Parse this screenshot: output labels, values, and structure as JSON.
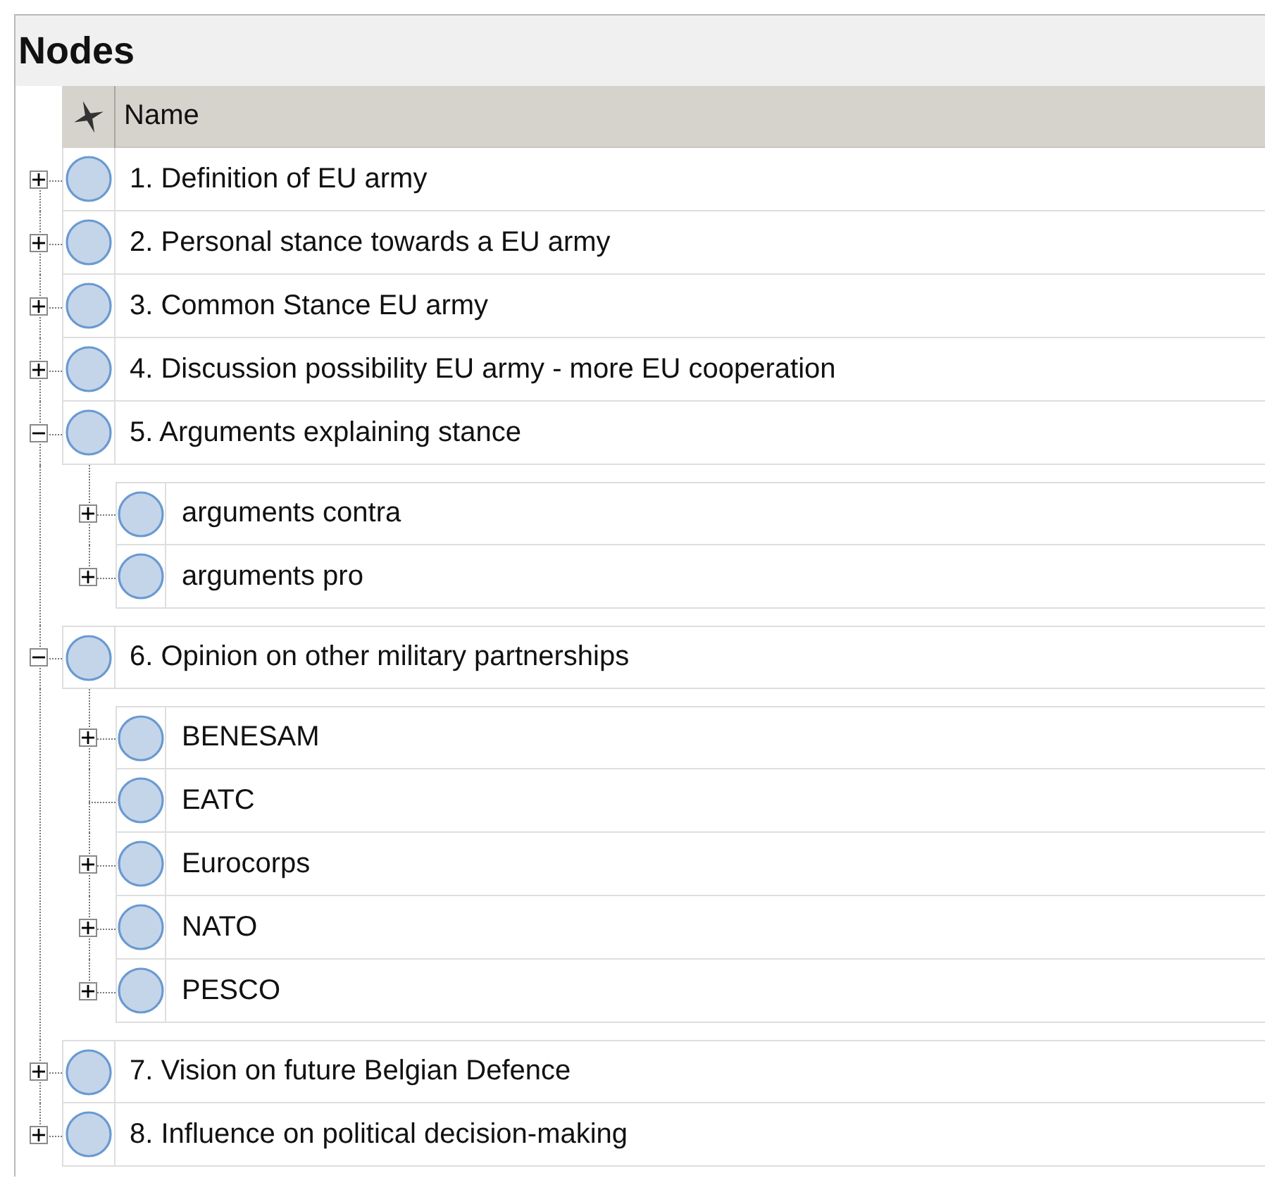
{
  "panel_title": "Nodes",
  "header": {
    "name_column": "Name"
  },
  "nodes": [
    {
      "label": "1. Definition of EU army",
      "kind": "branch",
      "expanded": false
    },
    {
      "label": "2. Personal stance towards a EU army",
      "kind": "branch",
      "expanded": false
    },
    {
      "label": "3. Common Stance EU army",
      "kind": "branch",
      "expanded": false
    },
    {
      "label": "4. Discussion possibility EU army - more EU cooperation",
      "kind": "branch",
      "expanded": false
    },
    {
      "label": "5. Arguments explaining stance",
      "kind": "branch",
      "expanded": true,
      "children": [
        {
          "label": "arguments contra",
          "kind": "branch",
          "expanded": false
        },
        {
          "label": "arguments pro",
          "kind": "branch",
          "expanded": false
        }
      ]
    },
    {
      "label": "6. Opinion on other military partnerships",
      "kind": "branch",
      "expanded": true,
      "children": [
        {
          "label": "BENESAM",
          "kind": "branch",
          "expanded": false
        },
        {
          "label": "EATC",
          "kind": "leaf"
        },
        {
          "label": "Eurocorps",
          "kind": "branch",
          "expanded": false
        },
        {
          "label": "NATO",
          "kind": "branch",
          "expanded": false
        },
        {
          "label": "PESCO",
          "kind": "branch",
          "expanded": false
        }
      ]
    },
    {
      "label": "7. Vision on future Belgian Defence",
      "kind": "branch",
      "expanded": false
    },
    {
      "label": "8. Influence on political decision-making",
      "kind": "branch",
      "expanded": false
    }
  ]
}
